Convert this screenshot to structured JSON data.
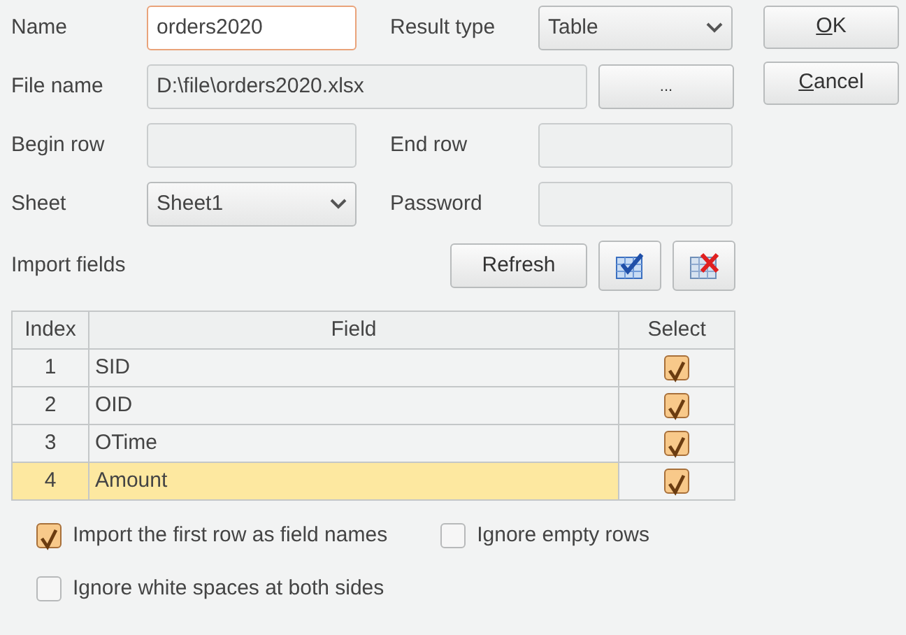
{
  "name": {
    "label": "Name",
    "value": "orders2020",
    "focused": true
  },
  "result_type": {
    "label": "Result type",
    "value": "Table"
  },
  "buttons": [
    {
      "label": "OK",
      "mnemonic_first": true
    },
    {
      "label": "Cancel",
      "mnemonic_first": true
    }
  ],
  "file_name": {
    "label": "File name",
    "value": "D:\\file\\orders2020.xlsx",
    "browse": "..."
  },
  "begin_row": {
    "label": "Begin row"
  },
  "end_row": {
    "label": "End row"
  },
  "sheet": {
    "label": "Sheet",
    "value": "Sheet1"
  },
  "password": {
    "label": "Password"
  },
  "import_fields": {
    "label": "Import fields",
    "refresh": "Refresh"
  },
  "table": {
    "columns": [
      "Index",
      "Field",
      "Select"
    ],
    "rows": [
      {
        "index": "1",
        "field": "SID",
        "checked": true,
        "selected": false
      },
      {
        "index": "2",
        "field": "OID",
        "checked": true,
        "selected": false
      },
      {
        "index": "3",
        "field": "OTime",
        "checked": true,
        "selected": false
      },
      {
        "index": "4",
        "field": "Amount",
        "checked": true,
        "selected": true
      }
    ]
  },
  "options": [
    {
      "label": "Import the first row as field names",
      "checked": true
    },
    {
      "label": "Ignore empty rows",
      "checked": false
    },
    {
      "label": "Ignore white spaces at both sides",
      "checked": false
    }
  ]
}
